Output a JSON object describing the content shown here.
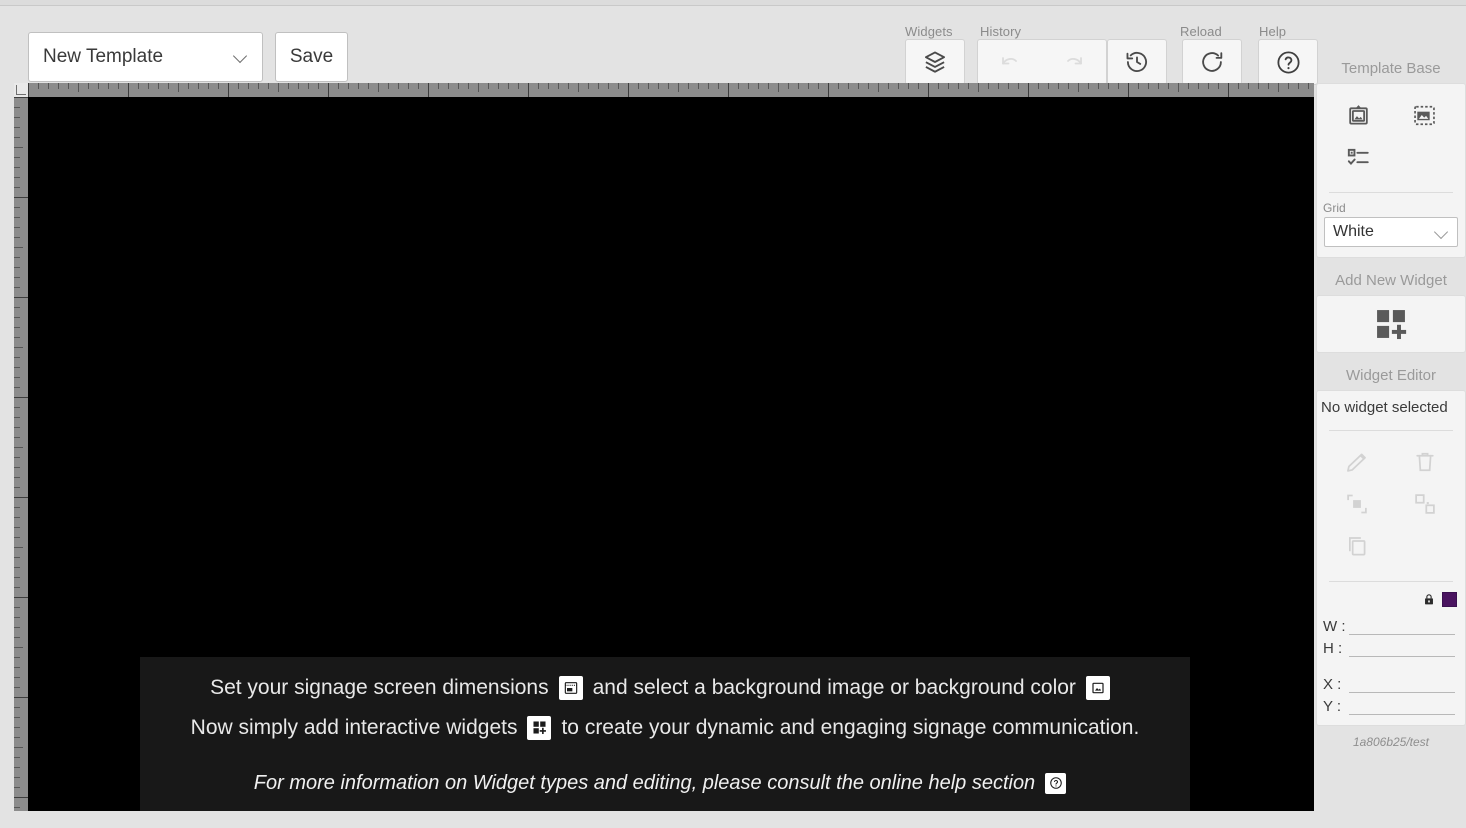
{
  "toolbar": {
    "template_select_value": "New Template",
    "save_label": "Save",
    "groups": {
      "widgets_label": "Widgets",
      "history_label": "History",
      "reload_label": "Reload",
      "help_label": "Help"
    },
    "icons": {
      "widgets": "layers-icon",
      "undo": "undo-icon",
      "redo": "redo-icon",
      "history": "history-restore-icon",
      "reload": "reload-icon",
      "help": "help-circle-icon"
    }
  },
  "canvas": {
    "background_color": "#000000",
    "message": {
      "panel_color": "#181818",
      "line1_part1": "Set your signage screen dimensions",
      "line1_part2": "and select a background image or background color",
      "line2_part1": "Now simply add interactive widgets",
      "line2_part2": "to create your dynamic and engaging signage communication.",
      "line3": "For more information on Widget types and editing, please consult the online help section",
      "icons": {
        "dimensions": "screen-dimensions-icon",
        "background": "background-image-icon",
        "widget": "add-widget-icon",
        "help": "help-circle-icon"
      }
    }
  },
  "sidebar": {
    "template_base": {
      "title": "Template Base",
      "icons": [
        {
          "name": "framed-picture-icon"
        },
        {
          "name": "background-crop-icon"
        },
        {
          "name": "checklist-icon"
        }
      ],
      "grid_label": "Grid",
      "grid_value": "White",
      "grid_options": [
        "White"
      ]
    },
    "add_new_widget": {
      "title": "Add New Widget",
      "icon": "add-widget-grid-icon"
    },
    "widget_editor": {
      "title": "Widget Editor",
      "status": "No widget selected",
      "actions": [
        {
          "name": "edit-pencil-icon",
          "enabled": false
        },
        {
          "name": "delete-trash-icon",
          "enabled": false
        },
        {
          "name": "bring-to-front-icon",
          "enabled": false
        },
        {
          "name": "send-to-back-icon",
          "enabled": false
        },
        {
          "name": "duplicate-copy-icon",
          "enabled": false
        }
      ],
      "lock_icon": "lock-closed-icon",
      "color_swatch": "#4a1460",
      "fields": [
        {
          "key": "W :",
          "value": ""
        },
        {
          "key": "H :",
          "value": ""
        },
        {
          "key": "X :",
          "value": ""
        },
        {
          "key": "Y :",
          "value": ""
        }
      ]
    },
    "version": "1a806b25/test"
  }
}
